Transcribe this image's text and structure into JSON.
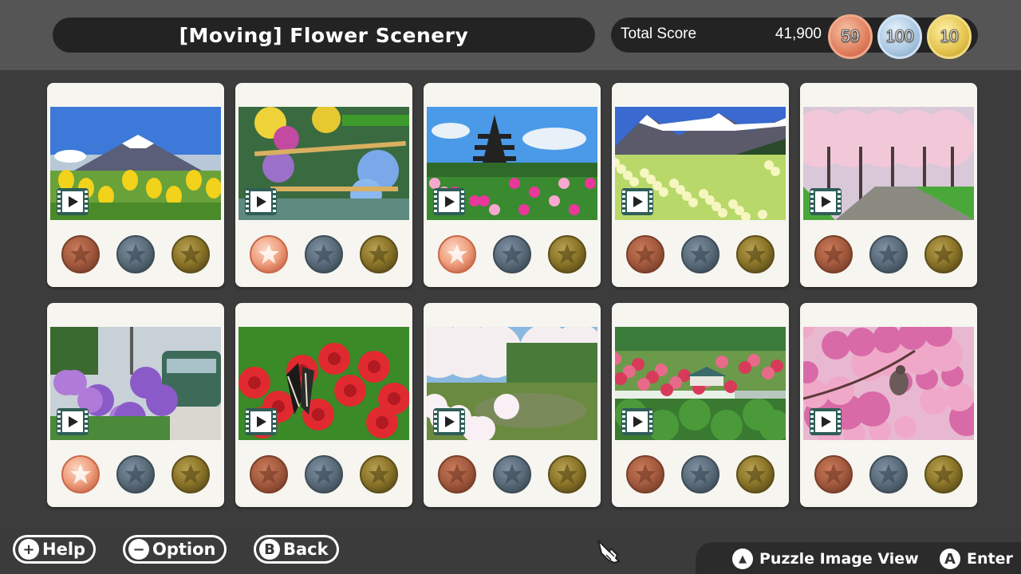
{
  "header": {
    "title": "[Moving] Flower Scenery",
    "score_label": "Total Score",
    "score_value": "41,900",
    "medal_counts": {
      "bronze": "59",
      "silver": "100",
      "gold": "10"
    }
  },
  "colors": {
    "bronze_earned": "#f0a07e",
    "bronze_dim": "#a35a3e",
    "silver_dim": "#5a6b7a",
    "gold_dim": "#8a7428",
    "video_badge": "#2f5d57"
  },
  "puzzles": [
    {
      "scene": "mount-fuji-tulips",
      "has_video": true,
      "medals": {
        "bronze": false,
        "silver": false,
        "gold": false
      }
    },
    {
      "scene": "hydrangeas-bamboo-water",
      "has_video": true,
      "medals": {
        "bronze": true,
        "silver": false,
        "gold": false
      }
    },
    {
      "scene": "pagoda-cosmos",
      "has_video": true,
      "medals": {
        "bronze": true,
        "silver": false,
        "gold": false
      }
    },
    {
      "scene": "alps-daffodils",
      "has_video": true,
      "medals": {
        "bronze": false,
        "silver": false,
        "gold": false
      }
    },
    {
      "scene": "cherry-blossom-path",
      "has_video": true,
      "medals": {
        "bronze": false,
        "silver": false,
        "gold": false
      }
    },
    {
      "scene": "hydrangeas-train",
      "has_video": true,
      "medals": {
        "bronze": true,
        "silver": false,
        "gold": false
      }
    },
    {
      "scene": "butterfly-red-spider-lily",
      "has_video": true,
      "medals": {
        "bronze": false,
        "silver": false,
        "gold": false
      }
    },
    {
      "scene": "cherry-blossom-pond",
      "has_video": true,
      "medals": {
        "bronze": false,
        "silver": false,
        "gold": false
      }
    },
    {
      "scene": "azalea-park",
      "has_video": true,
      "medals": {
        "bronze": false,
        "silver": false,
        "gold": false
      }
    },
    {
      "scene": "pink-blossoms-bird",
      "has_video": true,
      "medals": {
        "bronze": false,
        "silver": false,
        "gold": false
      }
    }
  ],
  "footer": {
    "help": {
      "button": "+",
      "label": "Help"
    },
    "option": {
      "button": "−",
      "label": "Option"
    },
    "back": {
      "button": "B",
      "label": "Back"
    },
    "image_view": {
      "button": "▲",
      "label": "Puzzle Image View"
    },
    "enter": {
      "button": "A",
      "label": "Enter"
    }
  }
}
